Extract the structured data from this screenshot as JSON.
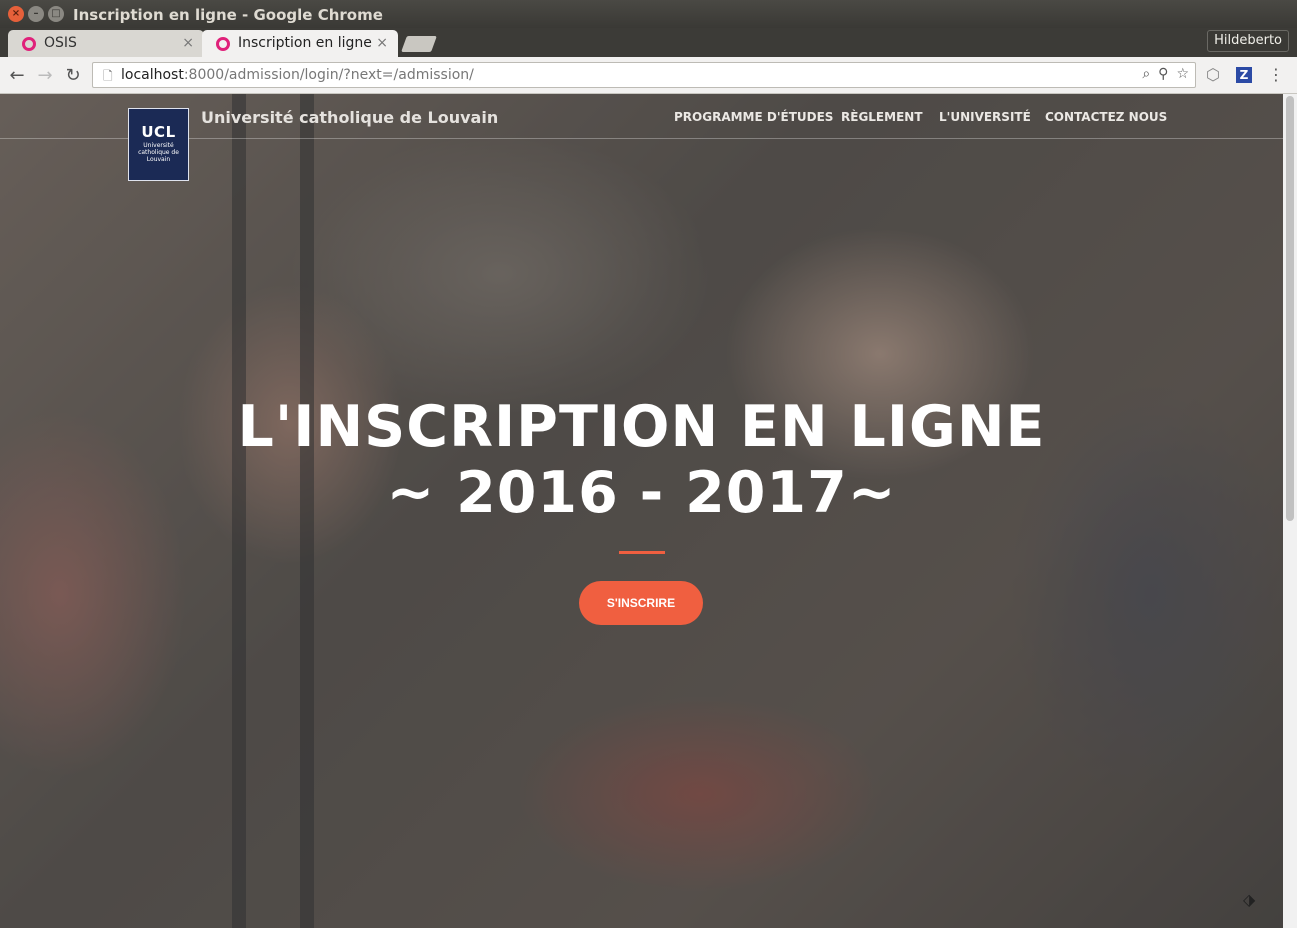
{
  "window": {
    "title": "Inscription en ligne - Google Chrome",
    "close_glyph": "×",
    "min_glyph": "–",
    "max_glyph": "□"
  },
  "tabs": [
    {
      "label": "OSIS",
      "close": "×"
    },
    {
      "label": "Inscription en ligne",
      "close": "×"
    }
  ],
  "profile": {
    "name": "Hildeberto"
  },
  "toolbar": {
    "back_glyph": "←",
    "forward_glyph": "→",
    "reload_glyph": "↻",
    "url_host": "localhost",
    "url_rest": ":8000/admission/login/?next=/admission/",
    "page_icon": "🗋",
    "zoom_icon": "⌕",
    "key_icon": "⚲",
    "star_icon": "☆",
    "ext_shield_icon": "⬡",
    "ext_z_label": "Z",
    "menu_icon": "⋮"
  },
  "site": {
    "logo_title": "UCL",
    "logo_subtitle": "Université catholique de Louvain",
    "brand": "Université catholique de Louvain",
    "menu": [
      "PROGRAMME D'ÉTUDES",
      "RÈGLEMENT",
      "L'UNIVERSITÉ",
      "CONTACTEZ NOUS"
    ],
    "hero_line1": "L'INSCRIPTION EN LIGNE",
    "hero_line2": "~ 2016 - 2017~",
    "cta": "S'INSCRIRE",
    "accent_color": "#f05f40",
    "corner_icon": "⬗"
  }
}
